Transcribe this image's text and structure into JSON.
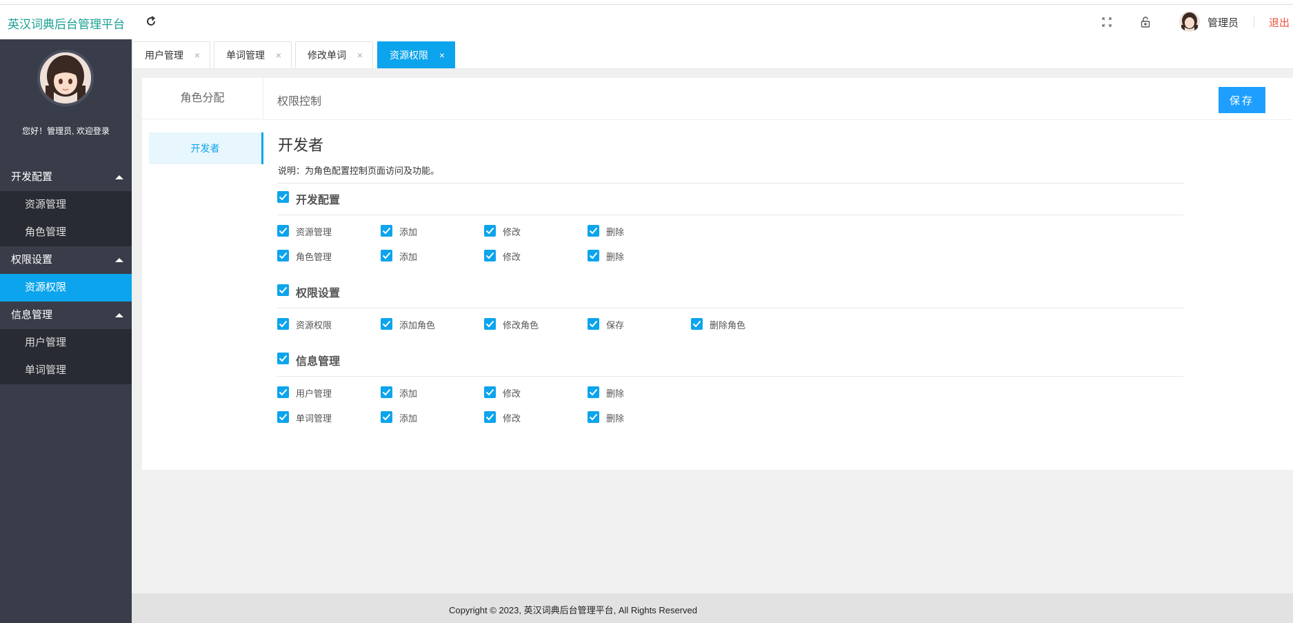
{
  "header": {
    "brand": "英汉词典后台管理平台",
    "user_name": "管理员",
    "logout": "退出"
  },
  "sidebar": {
    "welcome": "您好！管理员, 欢迎登录",
    "groups": [
      {
        "title": "开发配置",
        "items": [
          "资源管理",
          "角色管理"
        ]
      },
      {
        "title": "权限设置",
        "items": [
          "资源权限"
        ]
      },
      {
        "title": "信息管理",
        "items": [
          "用户管理",
          "单词管理"
        ]
      }
    ],
    "active_item": "资源权限"
  },
  "tabs": [
    {
      "label": "用户管理",
      "active": false
    },
    {
      "label": "单词管理",
      "active": false
    },
    {
      "label": "修改单词",
      "active": false
    },
    {
      "label": "资源权限",
      "active": true
    }
  ],
  "tab_close": "×",
  "panel": {
    "role_header": "角色分配",
    "perm_header": "权限控制",
    "save": "保存",
    "roles": [
      "开发者"
    ],
    "role_title": "开发者",
    "description": "说明：为角色配置控制页面访问及功能。"
  },
  "permissions": [
    {
      "group": "开发配置",
      "checked": true,
      "rows": [
        [
          {
            "label": "资源管理",
            "checked": true
          },
          {
            "label": "添加",
            "checked": true
          },
          {
            "label": "修改",
            "checked": true
          },
          {
            "label": "删除",
            "checked": true
          }
        ],
        [
          {
            "label": "角色管理",
            "checked": true
          },
          {
            "label": "添加",
            "checked": true
          },
          {
            "label": "修改",
            "checked": true
          },
          {
            "label": "删除",
            "checked": true
          }
        ]
      ]
    },
    {
      "group": "权限设置",
      "checked": true,
      "rows": [
        [
          {
            "label": "资源权限",
            "checked": true
          },
          {
            "label": "添加角色",
            "checked": true
          },
          {
            "label": "修改角色",
            "checked": true
          },
          {
            "label": "保存",
            "checked": true
          },
          {
            "label": "删除角色",
            "checked": true
          }
        ]
      ]
    },
    {
      "group": "信息管理",
      "checked": true,
      "rows": [
        [
          {
            "label": "用户管理",
            "checked": true
          },
          {
            "label": "添加",
            "checked": true
          },
          {
            "label": "修改",
            "checked": true
          },
          {
            "label": "删除",
            "checked": true
          }
        ],
        [
          {
            "label": "单词管理",
            "checked": true
          },
          {
            "label": "添加",
            "checked": true
          },
          {
            "label": "修改",
            "checked": true
          },
          {
            "label": "删除",
            "checked": true
          }
        ]
      ]
    }
  ],
  "footer": "Copyright © 2023, 英汉词典后台管理平台, All Rights Reserved",
  "colors": {
    "accent": "#0ca4ec",
    "brand": "#1aa094",
    "logout": "#e8553e",
    "sidebar": "#393d49"
  }
}
